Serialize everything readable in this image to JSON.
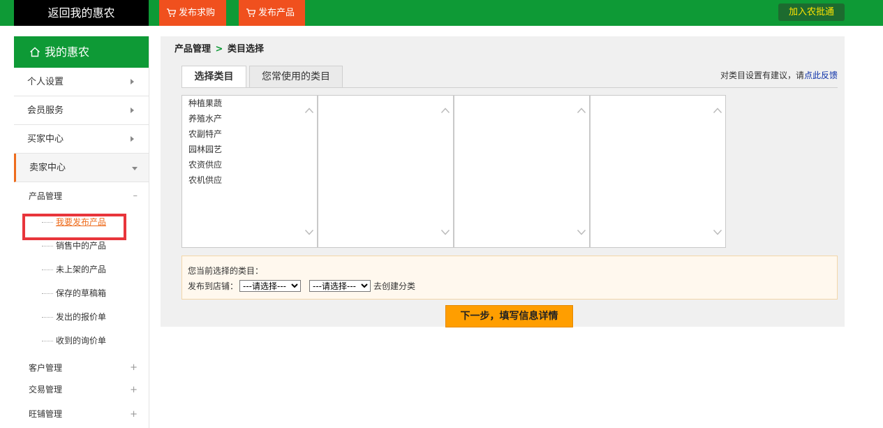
{
  "header": {
    "back_label": "返回我的惠农",
    "buy_label": "发布求购",
    "product_label": "发布产品",
    "join_label": "加入农批通"
  },
  "sidebar": {
    "title": "我的惠农",
    "menu": [
      {
        "label": "个人设置"
      },
      {
        "label": "会员服务"
      },
      {
        "label": "买家中心"
      },
      {
        "label": "卖家中心"
      }
    ],
    "product_group": "产品管理",
    "product_items": [
      "我要发布产品",
      "销售中的产品",
      "未上架的产品",
      "保存的草稿箱",
      "发出的报价单",
      "收到的询价单"
    ],
    "other_groups": [
      "客户管理",
      "交易管理",
      "旺铺管理"
    ]
  },
  "main": {
    "crumb_parent": "产品管理",
    "crumb_sep": ">",
    "crumb_current": "类目选择",
    "tabs": [
      {
        "label": "选择类目"
      },
      {
        "label": "您常使用的类目"
      }
    ],
    "feedback_prefix": "对类目设置有建议，请",
    "feedback_link": "点此反馈",
    "categories": [
      "种植果蔬",
      "养殖水产",
      "农副特产",
      "园林园艺",
      "农资供应",
      "农机供应"
    ],
    "current_label": "您当前选择的类目：",
    "shop_label": "发布到店铺：",
    "select_placeholder": "---请选择---",
    "create_link": "去创建分类",
    "next_button": "下一步，填写信息详情"
  },
  "colors": {
    "brand_green": "#0e9a36",
    "accent_orange": "#f0501e",
    "next_button": "#ff9e00",
    "highlight_red": "#e8353b"
  }
}
